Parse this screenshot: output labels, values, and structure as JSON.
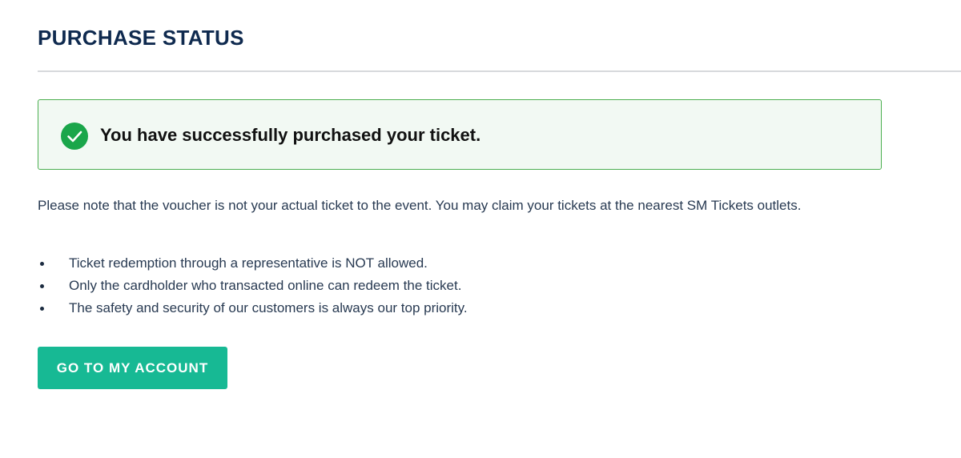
{
  "header": {
    "title": "PURCHASE STATUS"
  },
  "alert": {
    "icon": "check-circle-icon",
    "icon_color": "#1aa64a",
    "message": "You have successfully purchased your ticket."
  },
  "content": {
    "note": "Please note that the voucher is not your actual ticket to the event. You may claim your tickets at the nearest SM Tickets outlets.",
    "bullets": [
      "Ticket redemption through a representative is NOT allowed.",
      "Only the cardholder who transacted online can redeem the ticket.",
      "The safety and security of our customers is always our top priority."
    ]
  },
  "actions": {
    "account_button_label": "GO TO MY ACCOUNT",
    "account_button_color": "#17b994"
  }
}
